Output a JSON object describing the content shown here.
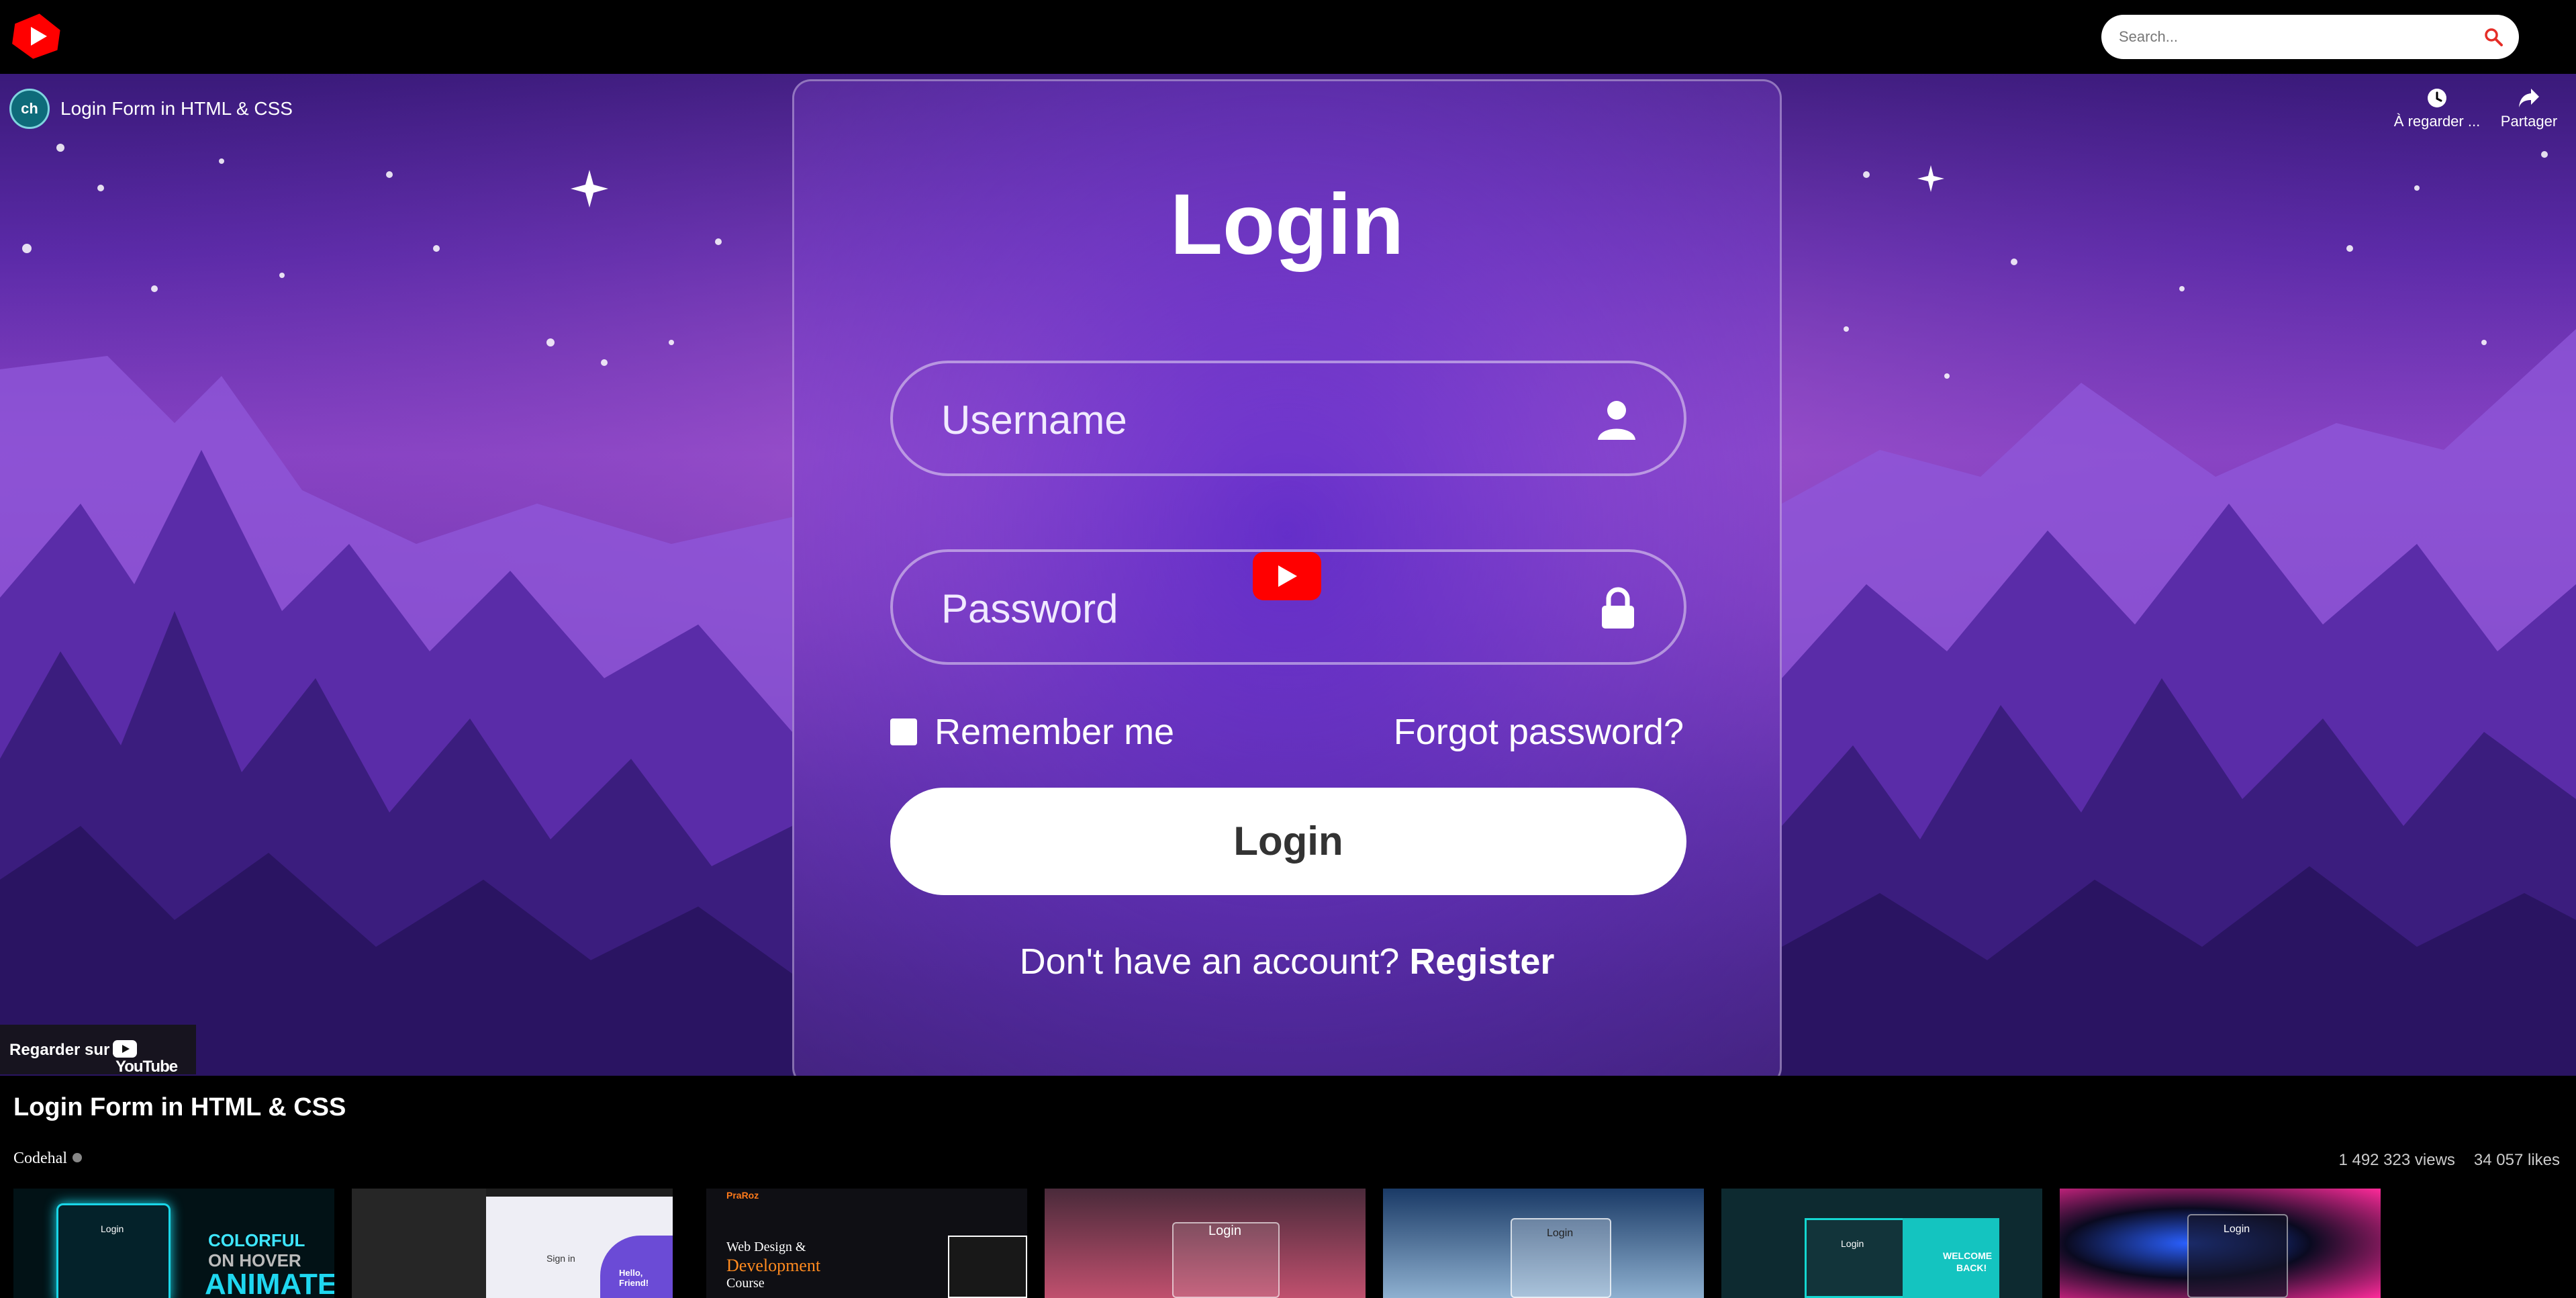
{
  "header": {
    "search_placeholder": "Search..."
  },
  "player": {
    "video_title": "Login Form in HTML & CSS",
    "channel_avatar_text": "ch",
    "watch_later_label": "À regarder ...",
    "share_label": "Partager",
    "watch_on_label": "Regarder sur",
    "watch_on_brand": "YouTube"
  },
  "video_frame": {
    "title": "Login",
    "username_placeholder": "Username",
    "password_placeholder": "Password",
    "remember_label": "Remember me",
    "forgot_label": "Forgot password?",
    "login_button": "Login",
    "no_account_text": "Don't have an account?",
    "register_link": "Register"
  },
  "details": {
    "title": "Login Form in HTML & CSS",
    "channel": "Codehal",
    "views": "1 492 323 views",
    "likes": "34 057 likes"
  },
  "related": [
    {
      "texts": [
        "Login",
        "COLORFUL",
        "ON HOVER",
        "ANIMATE!"
      ]
    },
    {
      "texts": [
        "Sign in",
        "Hello, Friend!"
      ]
    },
    {
      "texts": [
        "PraRoz",
        "Web Design &",
        "Development",
        "Course"
      ]
    },
    {
      "texts": [
        "Login"
      ]
    },
    {
      "texts": [
        "Login"
      ]
    },
    {
      "texts": [
        "Login",
        "WELCOME",
        "BACK!"
      ]
    },
    {
      "texts": [
        "Login"
      ]
    }
  ],
  "colors": {
    "brand_red": "#ff0000",
    "background": "#000000",
    "video_purple": "#8c45c8"
  }
}
